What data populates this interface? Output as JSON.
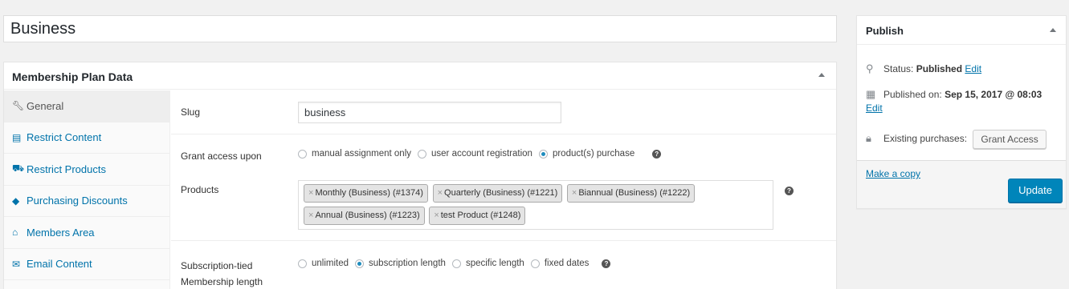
{
  "post": {
    "title": "Business"
  },
  "plan_box": {
    "title": "Membership Plan Data",
    "tabs": [
      {
        "label": "General",
        "icon": "wrench-icon"
      },
      {
        "label": "Restrict Content",
        "icon": "content-icon"
      },
      {
        "label": "Restrict Products",
        "icon": "cart-icon"
      },
      {
        "label": "Purchasing Discounts",
        "icon": "tag-icon"
      },
      {
        "label": "Members Area",
        "icon": "home-icon"
      },
      {
        "label": "Email Content",
        "icon": "email-icon"
      }
    ],
    "slug": {
      "label": "Slug",
      "value": "business"
    },
    "grant_access": {
      "label": "Grant access upon",
      "options": [
        "manual assignment only",
        "user account registration",
        "product(s) purchase"
      ],
      "selected": "product(s) purchase"
    },
    "products": {
      "label": "Products",
      "items": [
        "Monthly (Business) (#1374)",
        "Quarterly (Business) (#1221)",
        "Biannual (Business) (#1222)",
        "Annual (Business) (#1223)",
        "test Product (#1248)"
      ]
    },
    "length": {
      "label_line1": "Subscription-tied",
      "label_line2": "Membership length",
      "options": [
        "unlimited",
        "subscription length",
        "specific length",
        "fixed dates"
      ],
      "selected": "subscription length"
    }
  },
  "publish": {
    "title": "Publish",
    "status_label": "Status:",
    "status_value": "Published",
    "status_edit": "Edit",
    "published_label": "Published on:",
    "published_value": "Sep 15, 2017 @ 08:03",
    "published_edit": "Edit",
    "purchases_label": "Existing purchases:",
    "grant_button": "Grant Access",
    "copy_link": "Make a copy",
    "update_button": "Update"
  },
  "colors": {
    "accent": "#0073aa",
    "primary_button": "#0085ba",
    "background": "#f1f1f1"
  }
}
